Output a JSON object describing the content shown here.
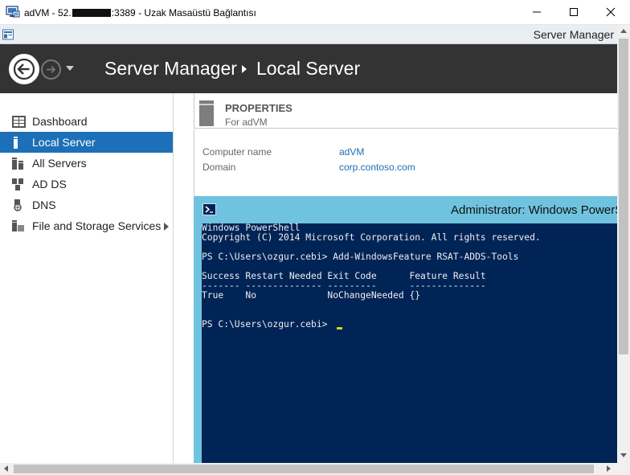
{
  "rdp": {
    "title_prefix": "adVM - 52.",
    "title_suffix": ":3389 - Uzak Masaüstü Bağlantısı"
  },
  "server_manager": {
    "window_title": "Server Manager",
    "breadcrumb": [
      "Server Manager",
      "Local Server"
    ]
  },
  "sidebar": {
    "items": [
      {
        "label": "Dashboard",
        "icon": "dashboard-icon",
        "active": false
      },
      {
        "label": "Local Server",
        "icon": "local-server-icon",
        "active": true
      },
      {
        "label": "All Servers",
        "icon": "all-servers-icon",
        "active": false
      },
      {
        "label": "AD DS",
        "icon": "ad-ds-icon",
        "active": false
      },
      {
        "label": "DNS",
        "icon": "dns-icon",
        "active": false
      },
      {
        "label": "File and Storage Services",
        "icon": "file-storage-icon",
        "active": false,
        "has_submenu": true
      }
    ]
  },
  "properties": {
    "title": "PROPERTIES",
    "subtitle": "For adVM",
    "rows": [
      {
        "key": "Computer name",
        "value": "adVM"
      },
      {
        "key": "Domain",
        "value": "corp.contoso.com"
      }
    ]
  },
  "powershell": {
    "title": "Administrator: Windows PowerS",
    "lines": [
      "Windows PowerShell",
      "Copyright (C) 2014 Microsoft Corporation. All rights reserved.",
      "",
      "PS C:\\Users\\ozgur.cebi> Add-WindowsFeature RSAT-ADDS-Tools",
      "",
      "Success Restart Needed Exit Code      Feature Result",
      "------- -------------- ---------      --------------",
      "True    No             NoChangeNeeded {}",
      "",
      "",
      "PS C:\\Users\\ozgur.cebi> "
    ]
  },
  "colors": {
    "header_bg": "#333333",
    "active_nav": "#1d70b7",
    "link": "#1a6fb5",
    "ps_frame": "#6fc3df",
    "ps_console_bg": "#012456",
    "ps_cursor": "#d8d800"
  }
}
